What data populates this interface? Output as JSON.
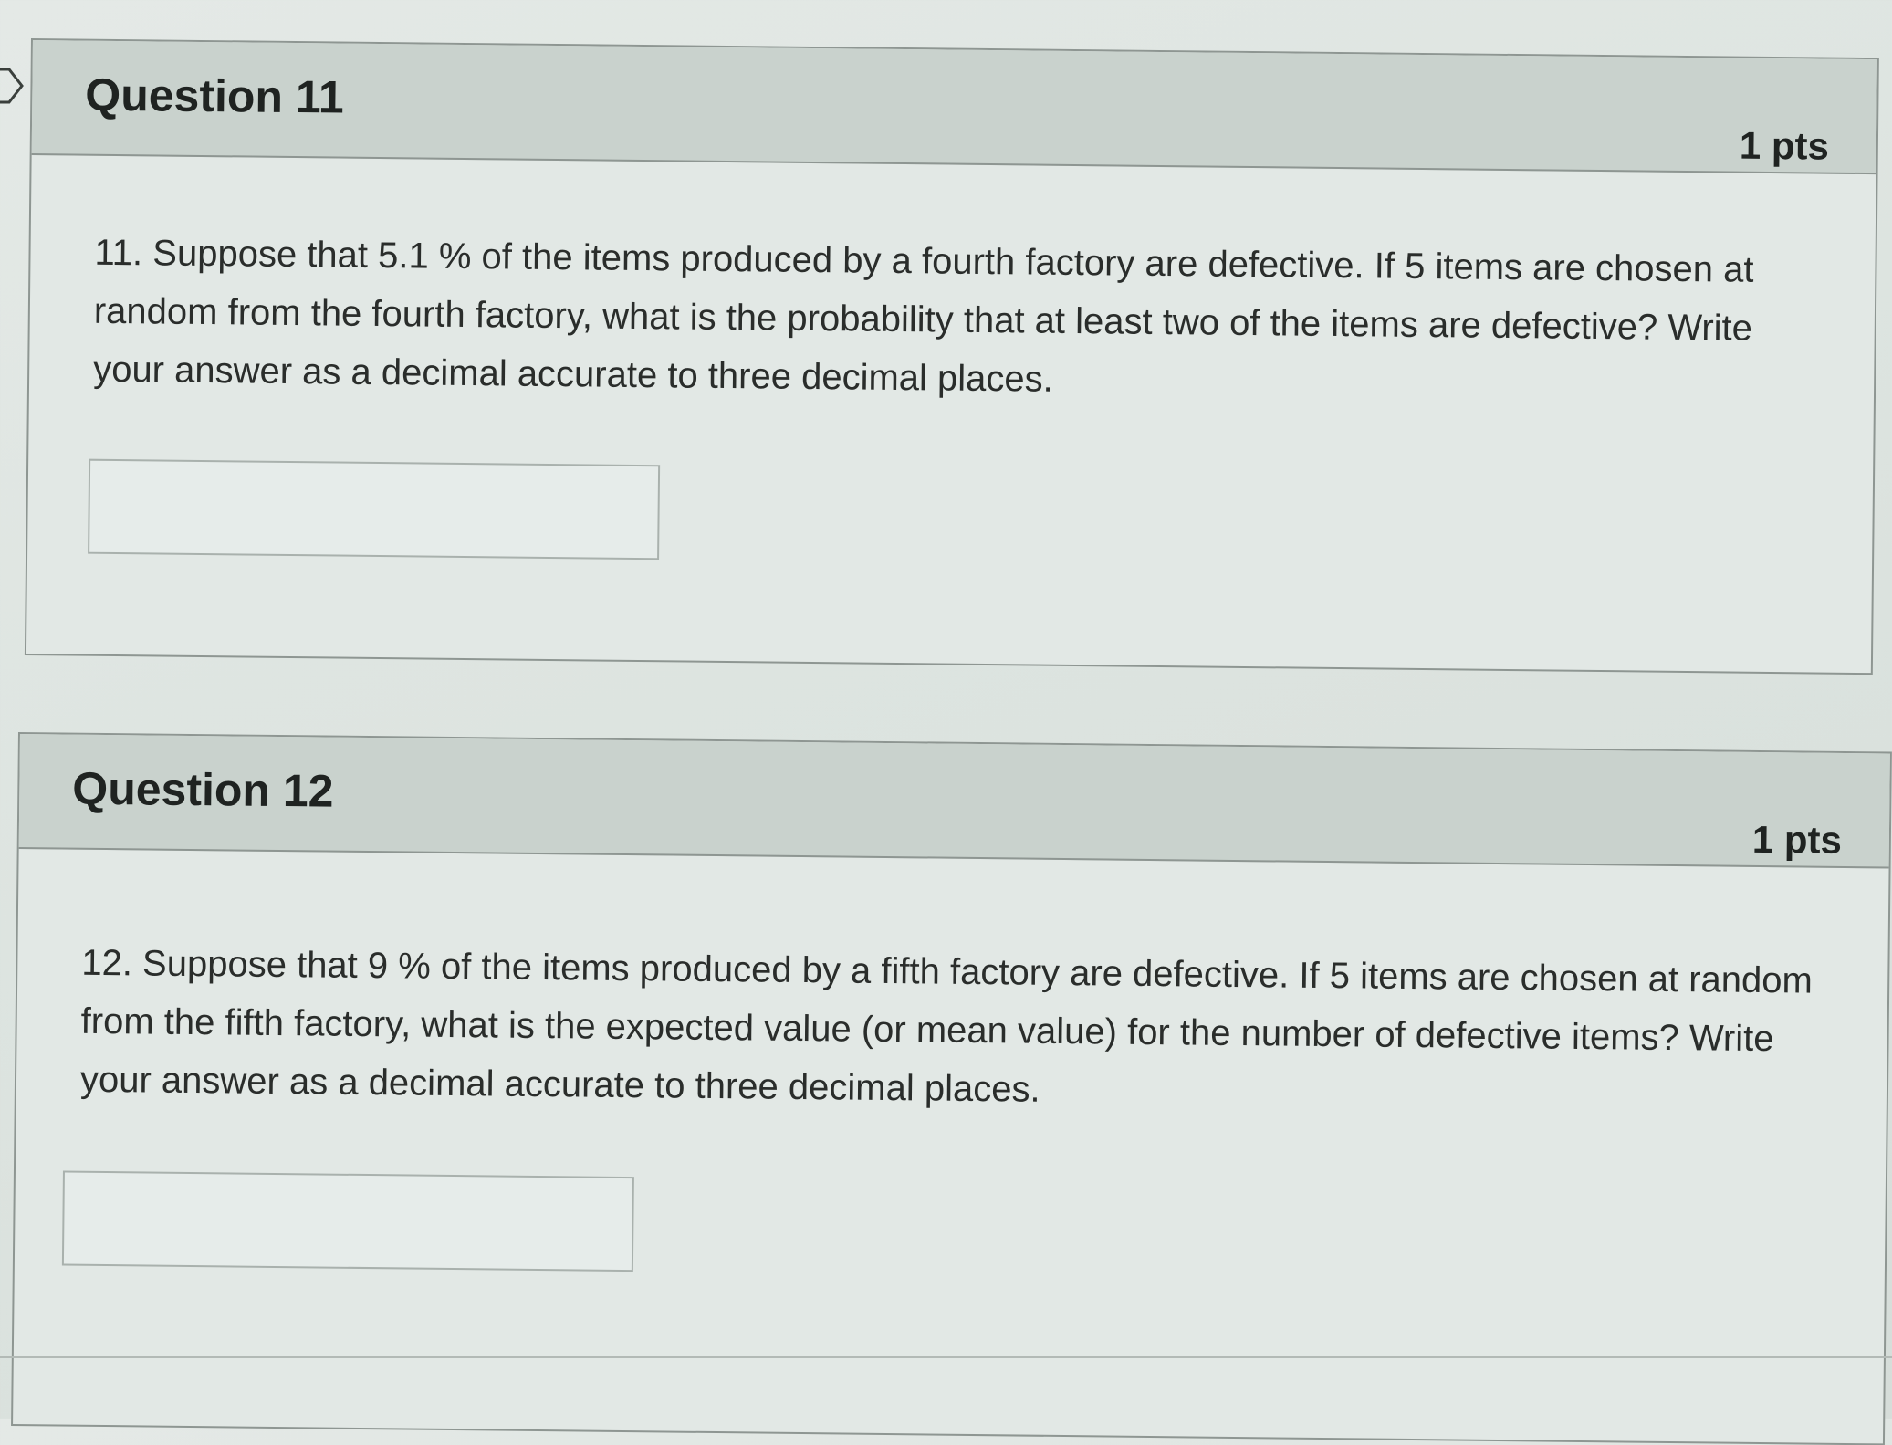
{
  "questions": [
    {
      "title": "Question 11",
      "points": "1 pts",
      "text": "11.  Suppose that 5.1 % of the items produced by a fourth factory are defective.  If 5 items are chosen at random from the fourth factory, what is the probability that at least two of the items are defective?  Write your answer as a decimal accurate to three decimal places.",
      "answer_value": ""
    },
    {
      "title": "Question 12",
      "points": "1 pts",
      "text": "12.  Suppose that 9 % of the items produced by a fifth factory are defective.  If 5 items are chosen at random from the fifth factory, what is the expected value (or mean value) for the number of defective items?  Write your answer as a decimal accurate to three decimal places.",
      "answer_value": ""
    }
  ],
  "icons": {
    "flag": "flag-icon"
  },
  "colors": {
    "header_bg": "#c9d2cd",
    "body_bg": "#e2e8e5",
    "border": "#8e9692"
  }
}
